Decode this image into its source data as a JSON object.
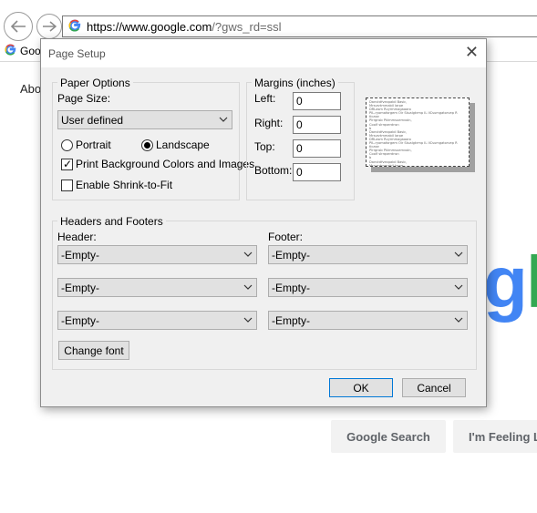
{
  "browser": {
    "url_host": "https://www.google.com",
    "url_rest": "/?gws_rd=ssl",
    "tab_title": "Goo",
    "about_link": "Abo",
    "g_letter": "G"
  },
  "google_page": {
    "logo_part_g": "g",
    "logo_part_l": "l",
    "search_button": "Google Search",
    "lucky_button": "I'm Feeling L"
  },
  "dialog": {
    "title": "Page Setup",
    "close": "✕",
    "paper_options": {
      "title": "Paper Options",
      "page_size_label": "Page Size:",
      "page_size_value": "User defined",
      "portrait": "Portrait",
      "landscape": "Landscape",
      "orientation_selected": "landscape",
      "print_background": "Print Background Colors and Images",
      "print_background_checked": true,
      "shrink_to_fit": "Enable Shrink-to-Fit",
      "shrink_to_fit_checked": false
    },
    "margins": {
      "title": "Margins (inches)",
      "left_label": "Left:",
      "left_value": "0",
      "right_label": "Right:",
      "right_value": "0",
      "top_label": "Top:",
      "top_value": "0",
      "bottom_label": "Bottom:",
      "bottom_value": "0"
    },
    "headers_footers": {
      "title": "Headers and Footers",
      "header_label": "Header:",
      "footer_label": "Footer:",
      "header_values": [
        "-Empty-",
        "-Empty-",
        "-Empty-"
      ],
      "footer_values": [
        "-Empty-",
        "-Empty-",
        "-Empty-"
      ],
      "change_font": "Change font"
    },
    "ok": "OK",
    "cancel": "Cancel"
  }
}
